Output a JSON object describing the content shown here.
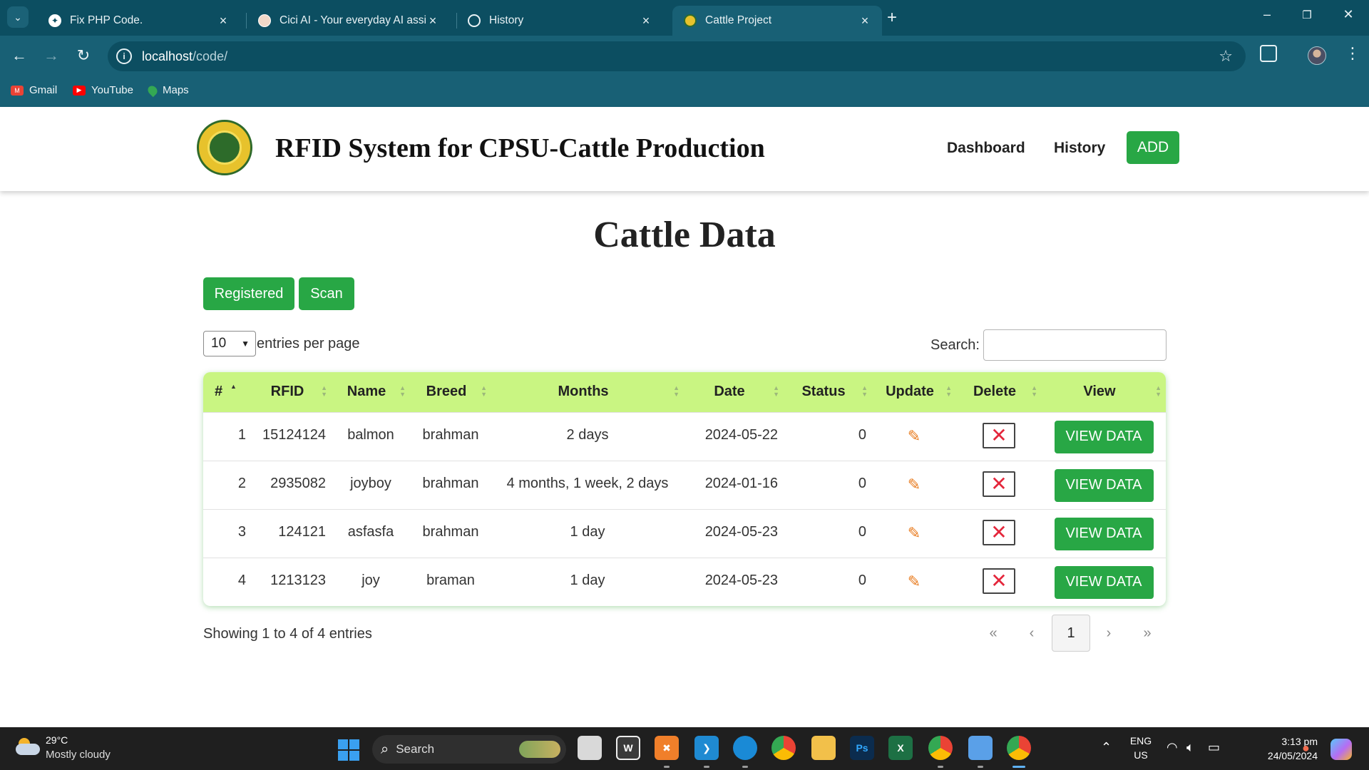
{
  "browser": {
    "tabs": [
      {
        "title": "Fix PHP Code.",
        "active": false
      },
      {
        "title": "Cici AI - Your everyday AI assist",
        "active": false
      },
      {
        "title": "History",
        "active": false
      },
      {
        "title": "Cattle Project",
        "active": true
      }
    ],
    "url_host": "localhost",
    "url_path": "/code/",
    "bookmarks": [
      "Gmail",
      "YouTube",
      "Maps"
    ]
  },
  "header": {
    "title": "RFID System for CPSU-Cattle Production",
    "nav": [
      "Dashboard",
      "History"
    ],
    "add_label": "ADD"
  },
  "page": {
    "heading": "Cattle Data",
    "buttons": [
      "Registered",
      "Scan"
    ],
    "entries_value": "10",
    "entries_label": "entries per page",
    "search_label": "Search:",
    "search_value": ""
  },
  "table": {
    "columns": [
      "#",
      "RFID",
      "Name",
      "Breed",
      "Months",
      "Date",
      "Status",
      "Update",
      "Delete",
      "View"
    ],
    "view_label": "VIEW DATA",
    "rows": [
      {
        "n": "1",
        "rfid": "15124124",
        "name": "balmon",
        "breed": "brahman",
        "months": "2 days",
        "date": "2024-05-22",
        "status": "0"
      },
      {
        "n": "2",
        "rfid": "2935082",
        "name": "joyboy",
        "breed": "brahman",
        "months": "4 months, 1 week, 2 days",
        "date": "2024-01-16",
        "status": "0"
      },
      {
        "n": "3",
        "rfid": "124121",
        "name": "asfasfa",
        "breed": "brahman",
        "months": "1 day",
        "date": "2024-05-23",
        "status": "0"
      },
      {
        "n": "4",
        "rfid": "1213123",
        "name": "joy",
        "breed": "braman",
        "months": "1 day",
        "date": "2024-05-23",
        "status": "0"
      }
    ],
    "info": "Showing 1 to 4 of 4 entries",
    "pagination": {
      "first": "«",
      "prev": "‹",
      "current": "1",
      "next": "›",
      "last": "»"
    }
  },
  "taskbar": {
    "temperature": "29°C",
    "weather": "Mostly cloudy",
    "search_label": "Search",
    "language": "ENG",
    "region": "US",
    "time": "3:13 pm",
    "date": "24/05/2024"
  },
  "colors": {
    "accent_green": "#28a745",
    "header_row": "#c9f582",
    "chrome": "#186075"
  }
}
